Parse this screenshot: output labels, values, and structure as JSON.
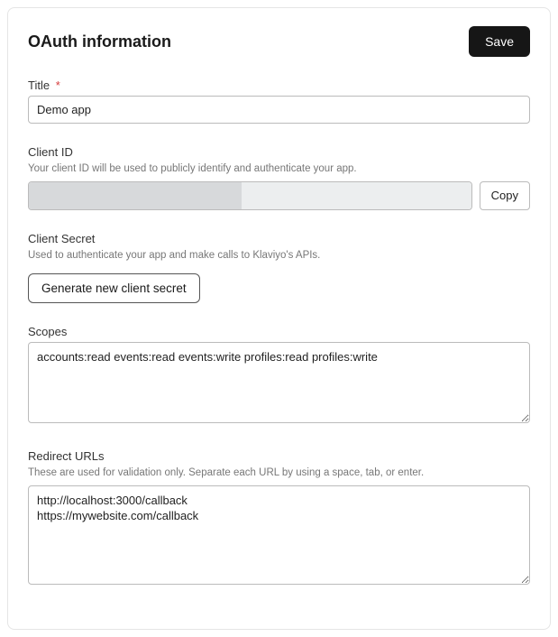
{
  "header": {
    "title": "OAuth information",
    "save_label": "Save"
  },
  "title_field": {
    "label": "Title",
    "required_marker": "*",
    "value": "Demo app"
  },
  "client_id": {
    "label": "Client ID",
    "help": "Your client ID will be used to publicly identify and authenticate your app.",
    "copy_label": "Copy"
  },
  "client_secret": {
    "label": "Client Secret",
    "help": "Used to authenticate your app and make calls to Klaviyo's APIs.",
    "generate_label": "Generate new client secret"
  },
  "scopes": {
    "label": "Scopes",
    "value": "accounts:read events:read events:write profiles:read profiles:write"
  },
  "redirect_urls": {
    "label": "Redirect URLs",
    "help": "These are used for validation only. Separate each URL by using a space, tab, or enter.",
    "value": "http://localhost:3000/callback\nhttps://mywebsite.com/callback"
  }
}
